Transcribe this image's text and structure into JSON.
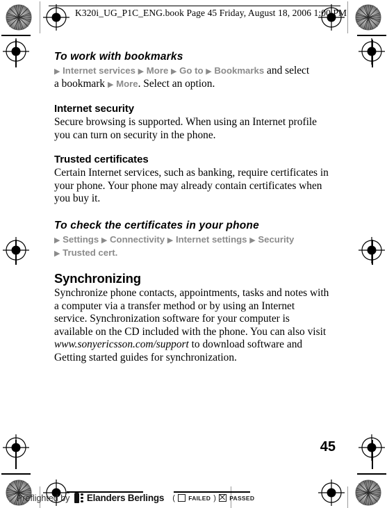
{
  "header": {
    "filename_line": "K320i_UG_P1C_ENG.book  Page 45  Friday, August 18, 2006 1:00 PM"
  },
  "content": {
    "blocks": [
      {
        "id": "work-with-bookmarks",
        "type": "procedure",
        "heading": "To work with bookmarks",
        "path_prefix_arrow": "▶",
        "path_line1_items": [
          "Internet services",
          "More",
          "Go to",
          "Bookmarks"
        ],
        "path_line1_tail": " and select",
        "path_line2_plain_lead": "a bookmark ",
        "path_line2_items": [
          "More"
        ],
        "path_line2_tail": ". Select an option."
      },
      {
        "id": "internet-security",
        "type": "subsection",
        "heading": "Internet security",
        "body": "Secure browsing is supported. When using an Internet profile you can turn on security in the phone."
      },
      {
        "id": "trusted-certificates",
        "type": "subsection",
        "heading": "Trusted certificates",
        "body": "Certain Internet services, such as banking, require certificates in your phone. Your phone may already contain certificates when you buy it."
      },
      {
        "id": "check-certificates",
        "type": "procedure",
        "heading": "To check the certificates in your phone",
        "path_prefix_arrow": "▶",
        "path_line1_items": [
          "Settings",
          "Connectivity",
          "Internet settings",
          "Security"
        ],
        "path_line2_items": [
          "Trusted cert."
        ]
      },
      {
        "id": "synchronizing",
        "type": "section",
        "heading": "Synchronizing",
        "body_part1": "Synchronize phone contacts, appointments, tasks and notes with a computer via a transfer method or by using an Internet service. Synchronization software for your computer is available on the CD included with the phone. You can also visit ",
        "body_url": "www.sonyericsson.com/support",
        "body_part2": " to download software and Getting started guides for synchronization."
      }
    ]
  },
  "page_number": "45",
  "footer": {
    "preflighted_by": "Preflighted by",
    "brand": "Elanders Berlings",
    "paren_open": "(",
    "failed_label": "FAILED",
    "paren_close": ")",
    "passed_label": "PASSED",
    "failed_checked": false,
    "passed_checked": true
  },
  "colors": {
    "nav_gray": "#8b8b8b",
    "text_black": "#000000",
    "mark_black": "#000000"
  }
}
